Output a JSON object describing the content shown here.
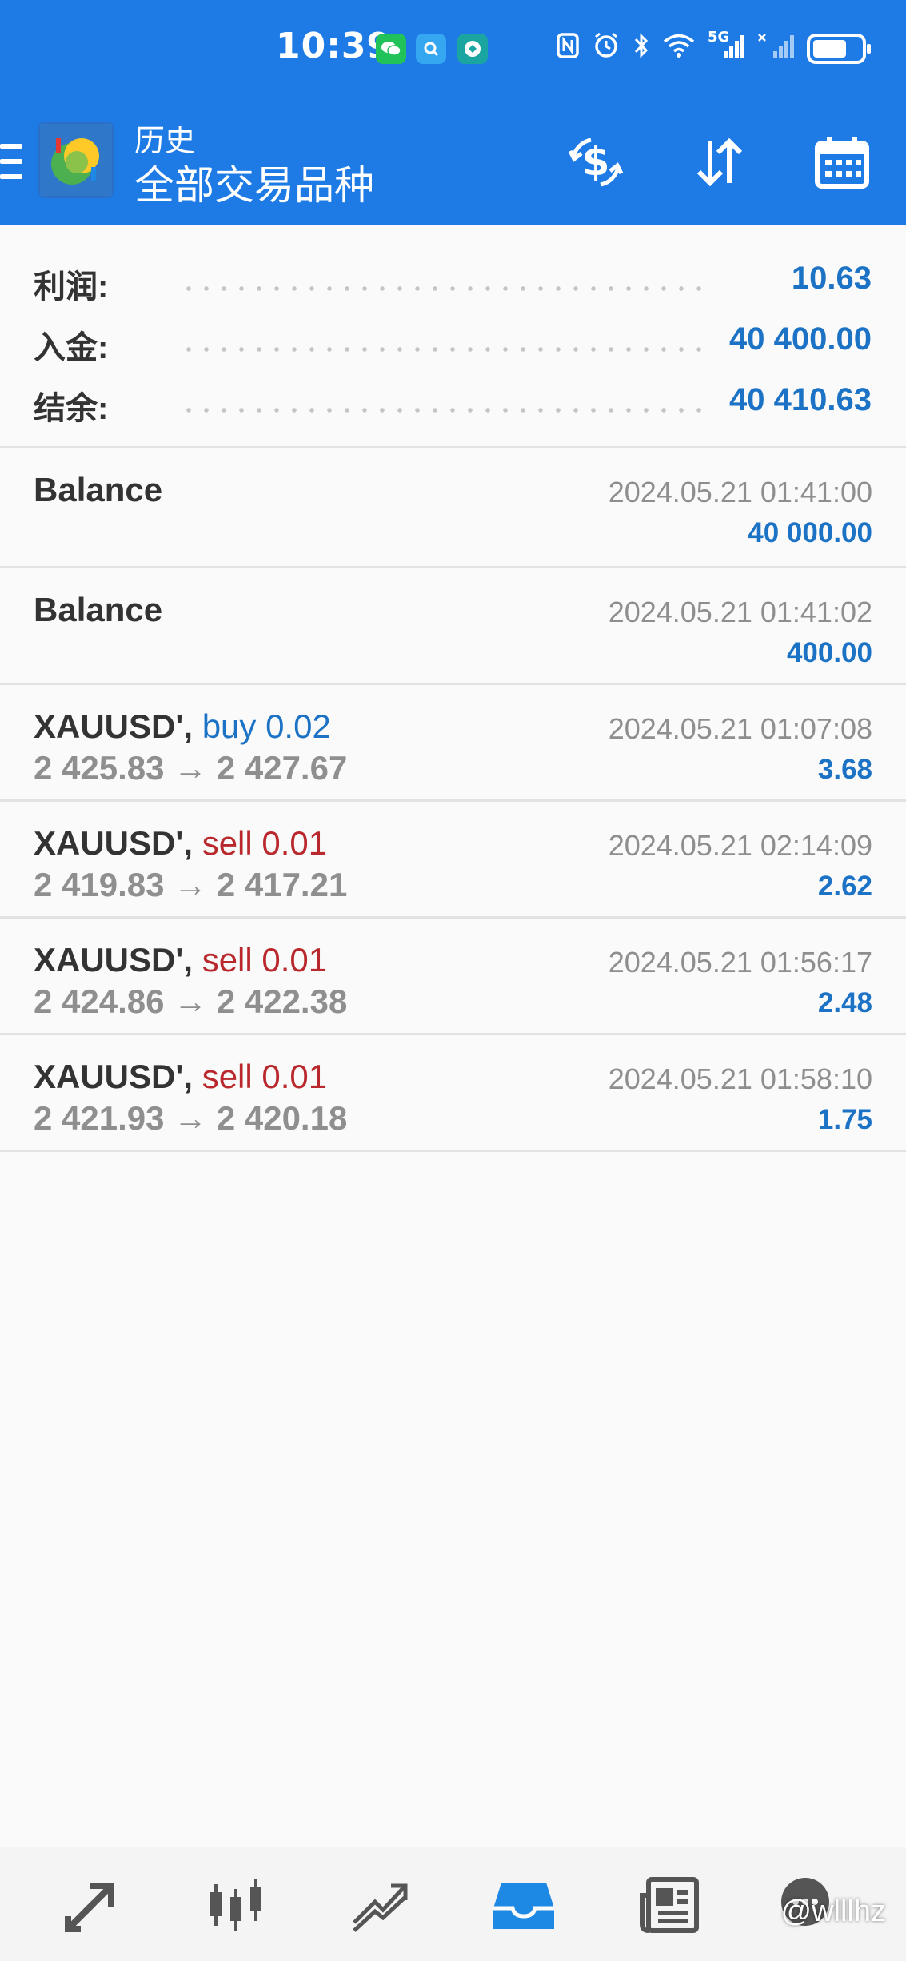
{
  "status_bar": {
    "time": "10:39",
    "net_label": "5G"
  },
  "app_bar": {
    "title": "历史",
    "subtitle": "全部交易品种"
  },
  "summary": {
    "profit_label": "利润:",
    "profit_value": "10.63",
    "deposit_label": "入金:",
    "deposit_value": "40 400.00",
    "balance_label": "结余:",
    "balance_value": "40 410.63"
  },
  "history": [
    {
      "name": "Balance",
      "side": "",
      "prices": "",
      "time": "2024.05.21 01:41:00",
      "profit": "40 000.00"
    },
    {
      "name": "Balance",
      "side": "",
      "prices": "",
      "time": "2024.05.21 01:41:02",
      "profit": "400.00"
    },
    {
      "name": "XAUUSD',",
      "side": "buy 0.02",
      "prices": "2 425.83 → 2 427.67",
      "time": "2024.05.21 01:07:08",
      "profit": "3.68"
    },
    {
      "name": "XAUUSD',",
      "side": "sell 0.01",
      "prices": "2 419.83 → 2 417.21",
      "time": "2024.05.21 02:14:09",
      "profit": "2.62"
    },
    {
      "name": "XAUUSD',",
      "side": "sell 0.01",
      "prices": "2 424.86 → 2 422.38",
      "time": "2024.05.21 01:56:17",
      "profit": "2.48"
    },
    {
      "name": "XAUUSD',",
      "side": "sell 0.01",
      "prices": "2 421.93 → 2 420.18",
      "time": "2024.05.21 01:58:10",
      "profit": "1.75"
    }
  ],
  "watermark": "@wlllhz",
  "colors": {
    "header": "#1e7be6",
    "value_blue": "#1c72c4",
    "sell_red": "#b8282c",
    "nav_active": "#1e88e5"
  },
  "icons": {
    "nav": [
      "trade-icon",
      "quotes-icon",
      "chart-icon",
      "history-icon",
      "news-icon",
      "chat-icon"
    ],
    "app_bar": [
      "dollar-refresh-icon",
      "sort-icon",
      "calendar-icon"
    ]
  }
}
